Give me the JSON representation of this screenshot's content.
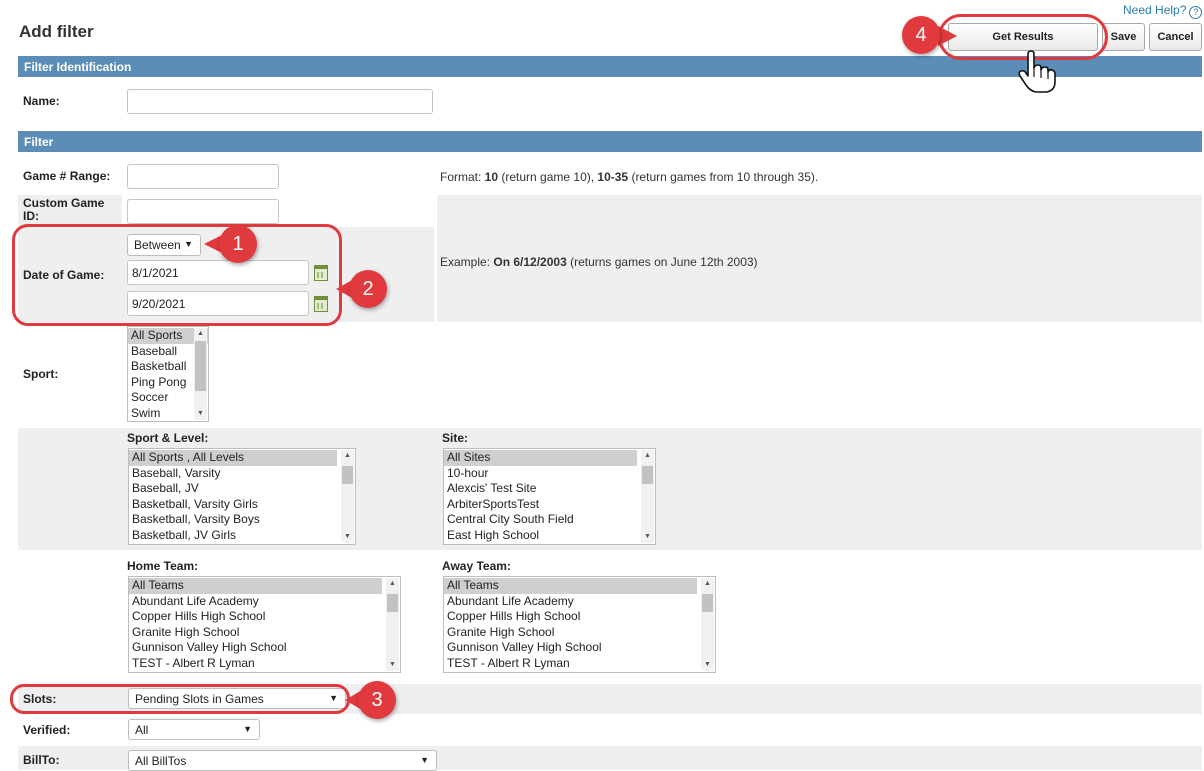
{
  "page": {
    "title": "Add filter",
    "help_label": "Need Help?",
    "help_icon": "?"
  },
  "toolbar": {
    "get_results_label": "Get Results",
    "save_label": "Save",
    "cancel_label": "Cancel"
  },
  "sections": {
    "identification": "Filter Identification",
    "filter": "Filter"
  },
  "fields": {
    "name_label": "Name:",
    "name_value": "",
    "game_range_label": "Game # Range:",
    "game_range_value": "",
    "game_range_note_prefix": "Format: ",
    "game_range_note_bold1": "10",
    "game_range_note_mid": " (return game 10), ",
    "game_range_note_bold2": "10-35",
    "game_range_note_suffix": " (return games from 10 through 35).",
    "custom_id_label": "Custom Game ID:",
    "custom_id_value": "",
    "date_label": "Date of Game:",
    "date_operator": "Between",
    "date_from": "8/1/2021",
    "date_to": "9/20/2021",
    "date_note_prefix": "Example: ",
    "date_note_bold": "On 6/12/2003",
    "date_note_suffix": " (returns games on June 12th 2003)",
    "sport_label": "Sport:",
    "sport_options": [
      "All Sports",
      "Baseball",
      "Basketball",
      "Ping Pong",
      "Soccer",
      "Swim"
    ],
    "sport_level_label": "Sport & Level:",
    "sport_level_options": [
      "All Sports , All Levels",
      "Baseball, Varsity",
      "Baseball, JV",
      "Basketball, Varsity Girls",
      "Basketball, Varsity Boys",
      "Basketball, JV Girls"
    ],
    "site_label": "Site:",
    "site_options": [
      "All Sites",
      "10-hour",
      "Alexcis' Test Site",
      "ArbiterSportsTest",
      "Central City South Field",
      "East High School"
    ],
    "home_team_label": "Home Team:",
    "home_team_options": [
      "All Teams",
      "Abundant Life Academy",
      "Copper Hills High School",
      "Granite High School",
      "Gunnison Valley High School",
      "TEST - Albert R Lyman"
    ],
    "away_team_label": "Away Team:",
    "away_team_options": [
      "All Teams",
      "Abundant Life Academy",
      "Copper Hills High School",
      "Granite High School",
      "Gunnison Valley High School",
      "TEST - Albert R Lyman"
    ],
    "slots_label": "Slots:",
    "slots_value": "Pending Slots in Games",
    "verified_label": "Verified:",
    "verified_value": "All",
    "billto_label": "BillTo:",
    "billto_value": "All BillTos"
  },
  "annotations": [
    "1",
    "2",
    "3",
    "4"
  ],
  "colors": {
    "section_bar": "#5b8db6",
    "annotation": "#e03a3e",
    "row_shade": "#efefef"
  }
}
